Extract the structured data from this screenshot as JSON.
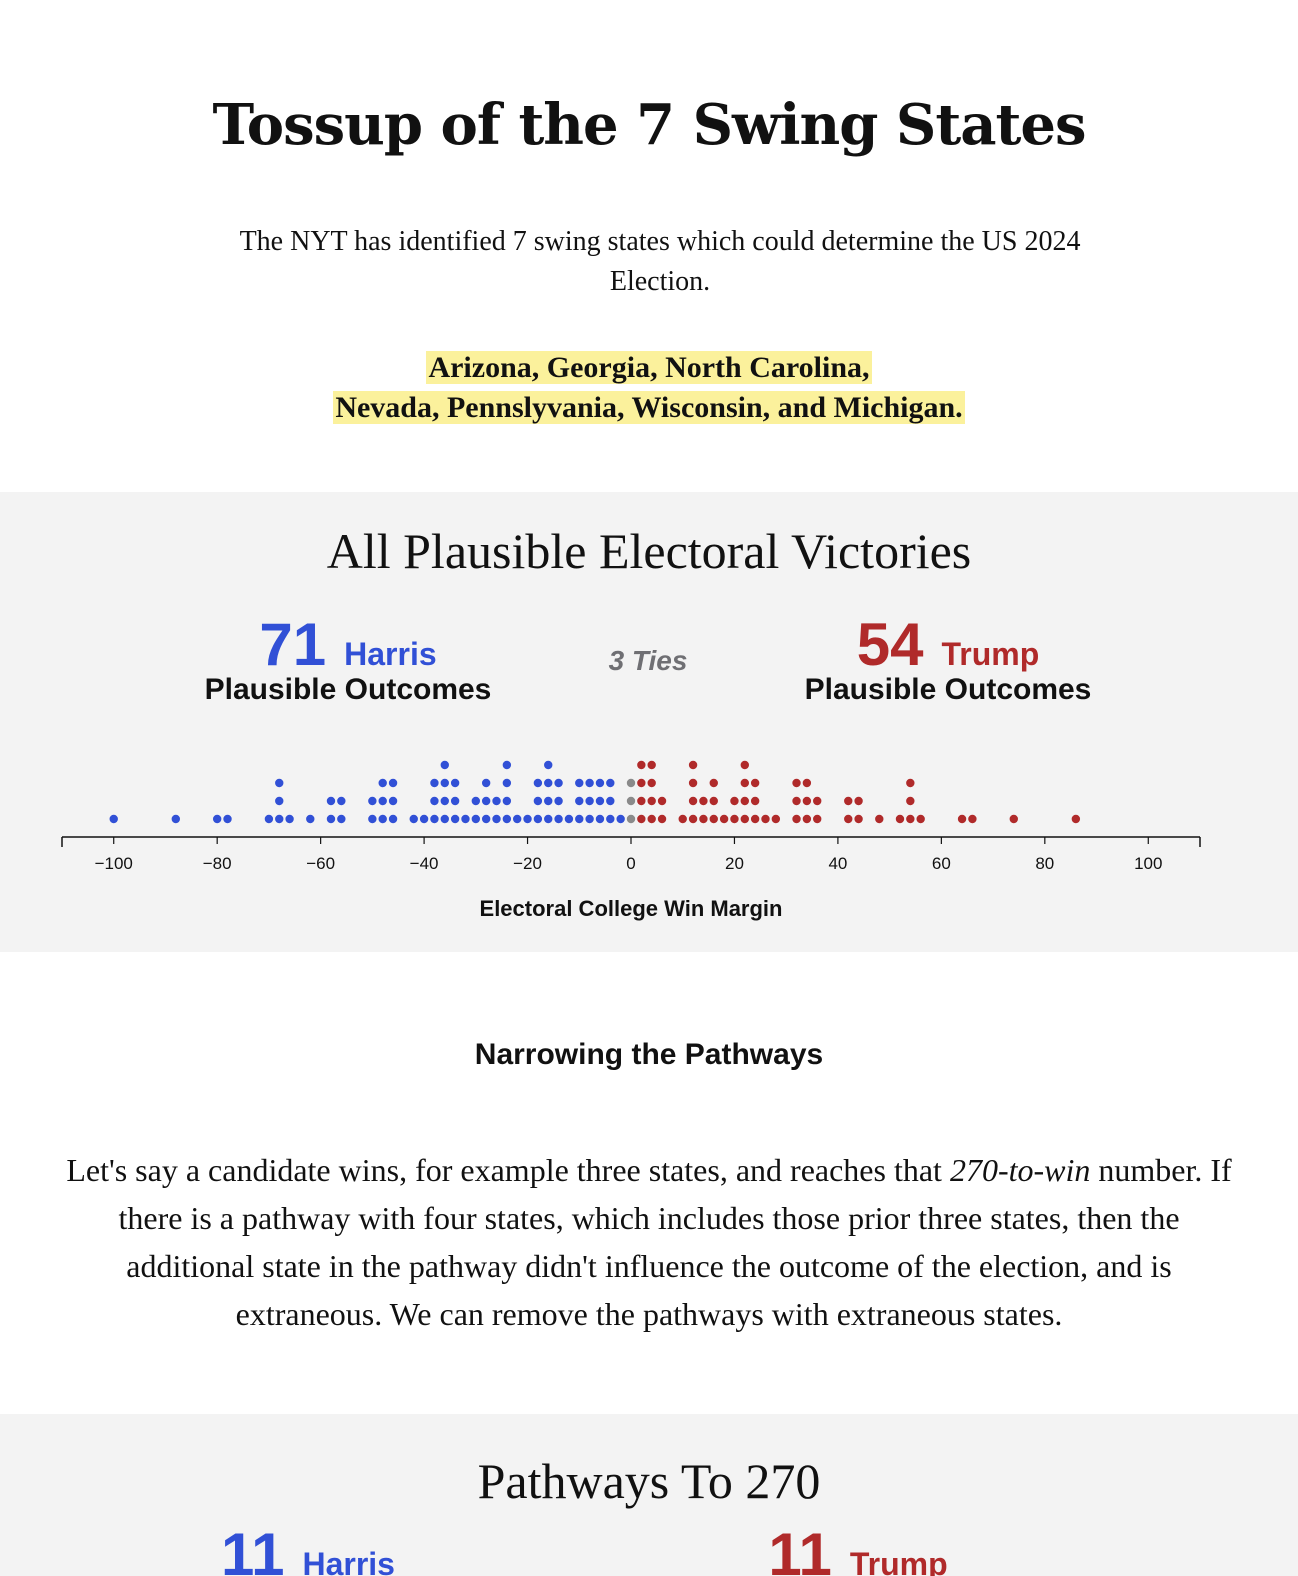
{
  "header": {
    "title": "Tossup of the 7 Swing States",
    "intro": "The NYT has identified 7 swing states which could determine the US 2024 Election.",
    "states_line1": "Arizona, Georgia, North Carolina,",
    "states_line2": "Nevada, Pennslyvania, Wisconsin, and Michigan."
  },
  "victories": {
    "title": "All Plausible Electoral Victories",
    "harris": {
      "count": "71",
      "name": "Harris",
      "sub": "Plausible Outcomes"
    },
    "ties": "3 Ties",
    "trump": {
      "count": "54",
      "name": "Trump",
      "sub": "Plausible Outcomes"
    }
  },
  "colors": {
    "harris": "#3150d6",
    "trump": "#b02a2a",
    "tie": "#8a8a8a",
    "highlight": "#fbf19c",
    "panel": "#f3f3f3"
  },
  "chart_data": {
    "type": "scatter",
    "subtype": "dot-plot (stacked)",
    "xlabel": "Electoral College Win Margin",
    "xlim": [
      -110,
      110
    ],
    "ticks": [
      -100,
      -80,
      -60,
      -40,
      -20,
      0,
      20,
      40,
      60,
      80,
      100
    ],
    "tick_labels": [
      "−100",
      "−80",
      "−60",
      "−40",
      "−20",
      "0",
      "20",
      "40",
      "60",
      "80",
      "100"
    ],
    "series": [
      {
        "name": "Harris",
        "color": "#3150d6",
        "points": [
          [
            -100,
            1
          ],
          [
            -88,
            1
          ],
          [
            -80,
            1
          ],
          [
            -78,
            1
          ],
          [
            -70,
            1
          ],
          [
            -68,
            3
          ],
          [
            -66,
            1
          ],
          [
            -62,
            1
          ],
          [
            -58,
            2
          ],
          [
            -56,
            2
          ],
          [
            -50,
            2
          ],
          [
            -48,
            3
          ],
          [
            -46,
            3
          ],
          [
            -42,
            1
          ],
          [
            -40,
            1
          ],
          [
            -38,
            3
          ],
          [
            -36,
            4
          ],
          [
            -34,
            3
          ],
          [
            -32,
            1
          ],
          [
            -30,
            2
          ],
          [
            -28,
            3
          ],
          [
            -26,
            2
          ],
          [
            -24,
            4
          ],
          [
            -22,
            1
          ],
          [
            -20,
            1
          ],
          [
            -18,
            3
          ],
          [
            -16,
            4
          ],
          [
            -14,
            3
          ],
          [
            -12,
            1
          ],
          [
            -10,
            3
          ],
          [
            -8,
            3
          ],
          [
            -6,
            3
          ],
          [
            -4,
            3
          ],
          [
            -2,
            1
          ]
        ]
      },
      {
        "name": "Ties",
        "color": "#8a8a8a",
        "points": [
          [
            0,
            3
          ]
        ]
      },
      {
        "name": "Trump",
        "color": "#b02a2a",
        "points": [
          [
            2,
            4
          ],
          [
            4,
            4
          ],
          [
            6,
            2
          ],
          [
            10,
            1
          ],
          [
            12,
            4
          ],
          [
            14,
            2
          ],
          [
            16,
            3
          ],
          [
            18,
            1
          ],
          [
            20,
            2
          ],
          [
            22,
            4
          ],
          [
            24,
            3
          ],
          [
            26,
            1
          ],
          [
            28,
            1
          ],
          [
            32,
            3
          ],
          [
            34,
            3
          ],
          [
            36,
            2
          ],
          [
            42,
            2
          ],
          [
            44,
            2
          ],
          [
            48,
            1
          ],
          [
            52,
            1
          ],
          [
            54,
            3
          ],
          [
            56,
            1
          ],
          [
            64,
            1
          ],
          [
            66,
            1
          ],
          [
            74,
            1
          ],
          [
            86,
            1
          ]
        ]
      }
    ]
  },
  "narrowing": {
    "heading": "Narrowing the Pathways",
    "p_before": "Let's say a candidate wins, for example three states, and reaches that ",
    "p_italic": "270-to-win",
    "p_after": " number. If there is a pathway with four states, which includes those prior three states, then the additional state in the pathway didn't influence the outcome of the election, and is extraneous. We can remove the pathways with extraneous states."
  },
  "pathways": {
    "title": "Pathways To 270",
    "harris": {
      "count": "11",
      "name": "Harris"
    },
    "trump": {
      "count": "11",
      "name": "Trump"
    }
  }
}
